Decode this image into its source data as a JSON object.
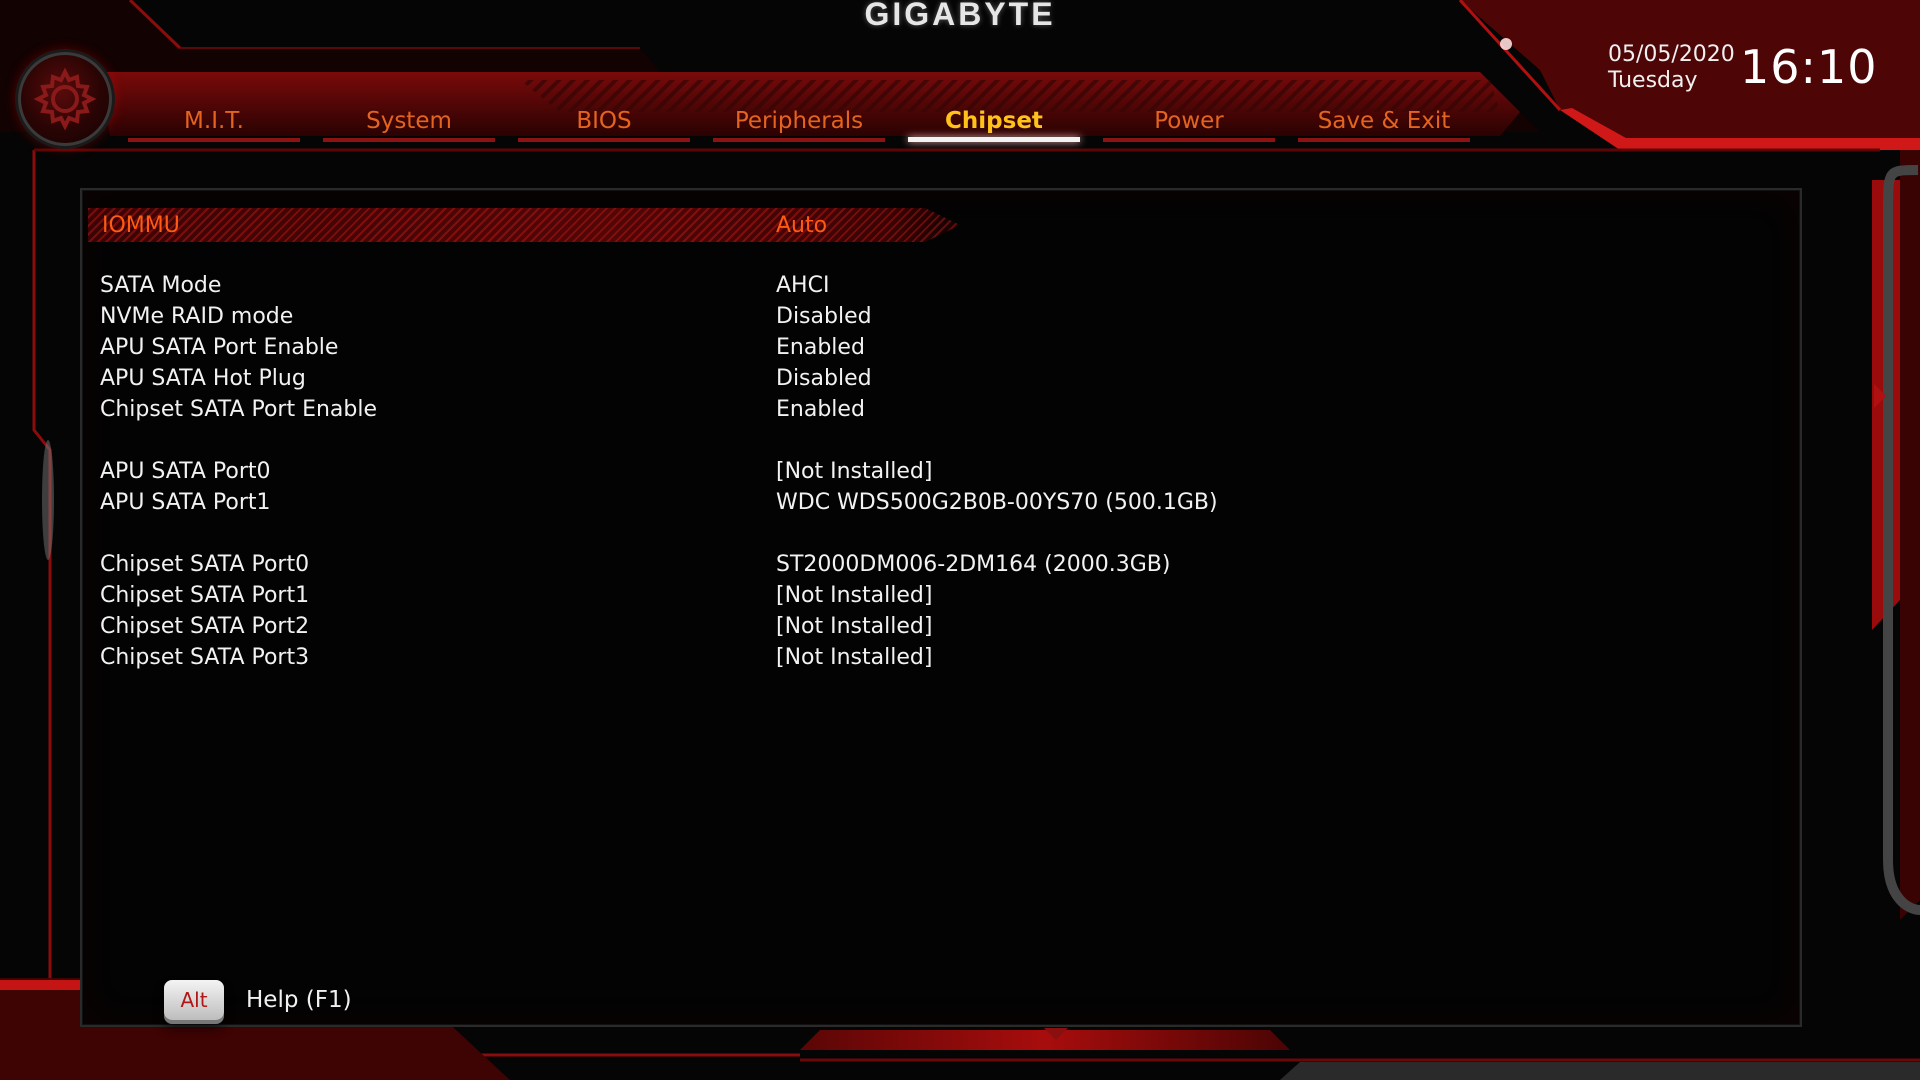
{
  "brand": "GIGABYTE",
  "datetime": {
    "date": "05/05/2020",
    "day": "Tuesday",
    "time": "16:10"
  },
  "nav": {
    "tabs": [
      {
        "label": "M.I.T.",
        "active": false
      },
      {
        "label": "System",
        "active": false
      },
      {
        "label": "BIOS",
        "active": false
      },
      {
        "label": "Peripherals",
        "active": false
      },
      {
        "label": "Chipset",
        "active": true
      },
      {
        "label": "Power",
        "active": false
      },
      {
        "label": "Save & Exit",
        "active": false
      }
    ]
  },
  "settings": [
    {
      "label": "IOMMU",
      "value": "Auto",
      "selected": true
    },
    {
      "label": "SATA Mode",
      "value": "AHCI"
    },
    {
      "label": "NVMe RAID mode",
      "value": "Disabled"
    },
    {
      "label": "APU SATA Port Enable",
      "value": "Enabled"
    },
    {
      "label": "APU SATA Hot Plug",
      "value": "Disabled"
    },
    {
      "label": "Chipset SATA Port Enable",
      "value": "Enabled"
    },
    {
      "label": "APU SATA Port0",
      "value": "[Not Installed]"
    },
    {
      "label": "APU SATA Port1",
      "value": "WDC  WDS500G2B0B-00YS70 (500.1GB)"
    },
    {
      "label": "Chipset SATA Port0",
      "value": "ST2000DM006-2DM164 (2000.3GB)"
    },
    {
      "label": "Chipset SATA Port1",
      "value": "[Not Installed]"
    },
    {
      "label": "Chipset SATA Port2",
      "value": "[Not Installed]"
    },
    {
      "label": "Chipset SATA Port3",
      "value": "[Not Installed]"
    }
  ],
  "help": {
    "key": "Alt",
    "label": "Help (F1)"
  },
  "icons": {
    "settings": "gear-icon"
  },
  "colors": {
    "accent_red": "#c01414",
    "tab_text": "#e2641f",
    "tab_active": "#ffc21a",
    "selected_text": "#ff5a12",
    "text": "#f2f2f2"
  }
}
